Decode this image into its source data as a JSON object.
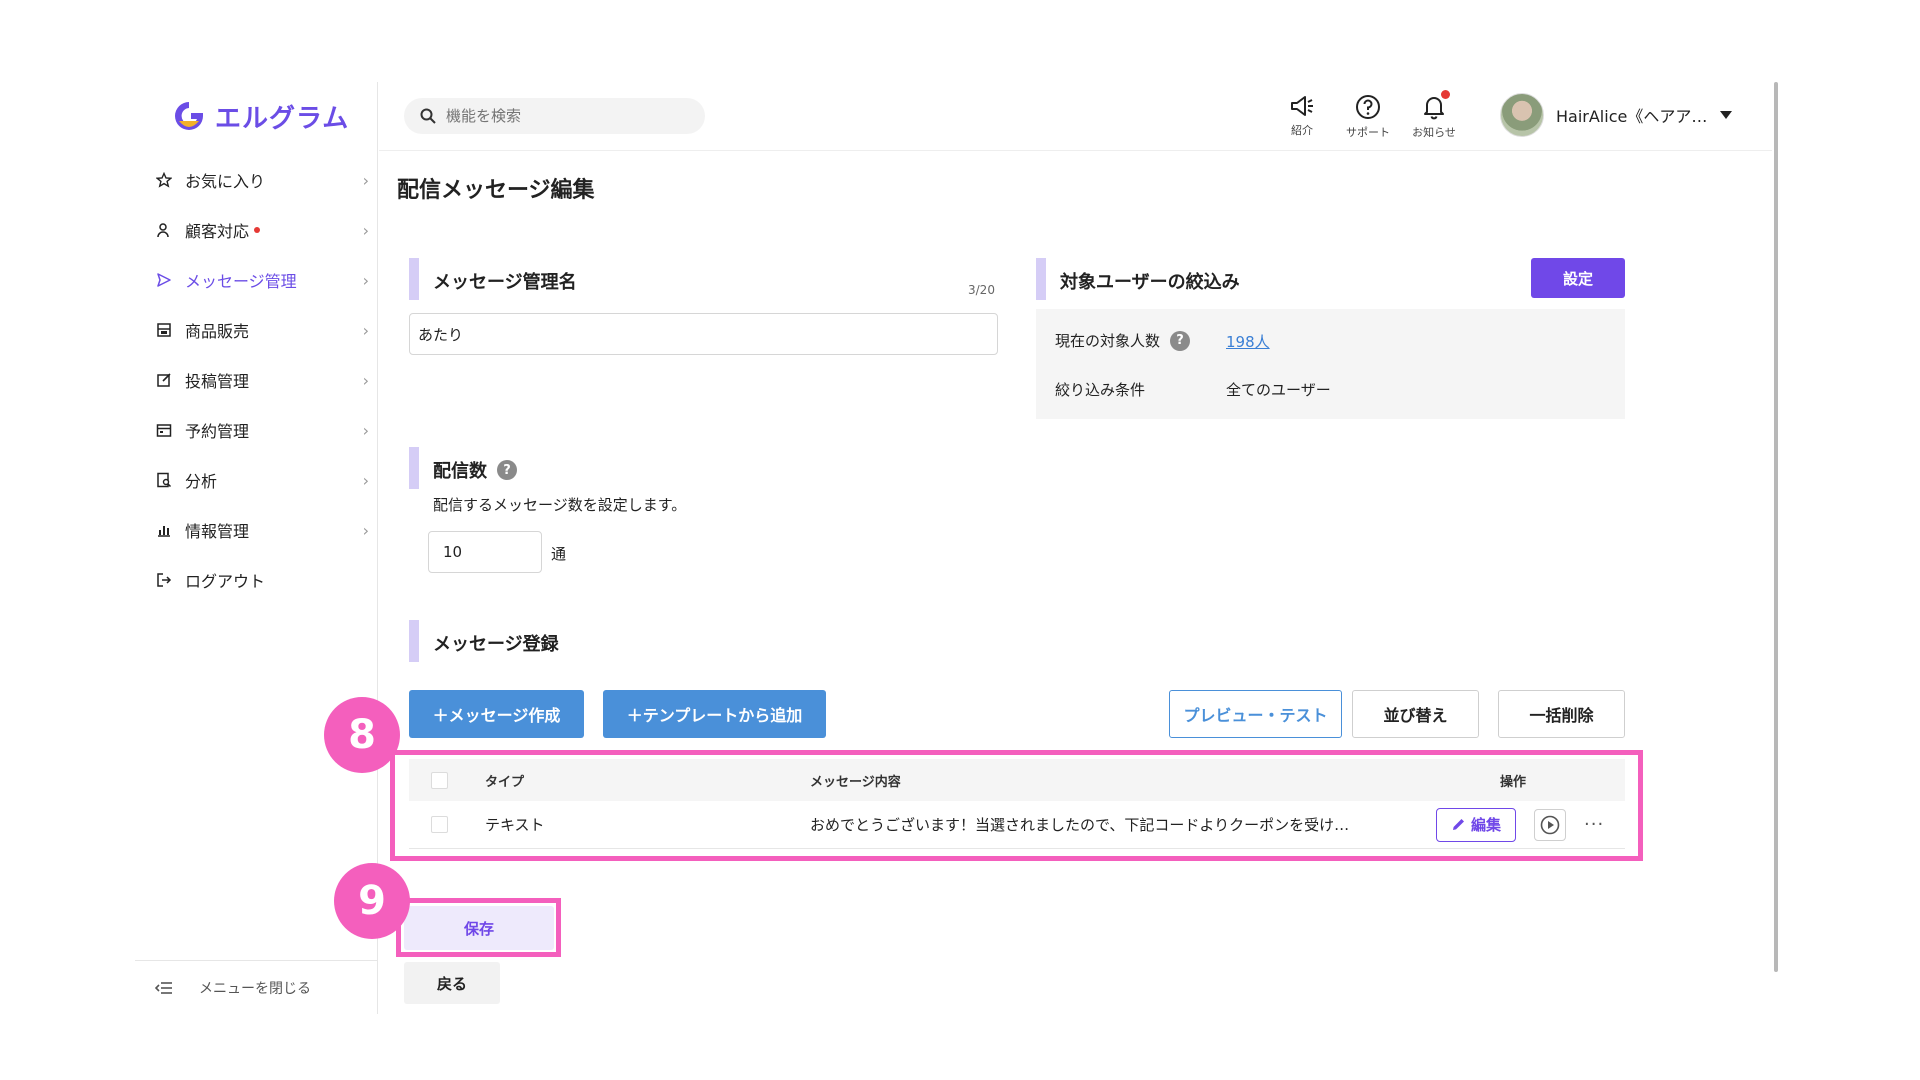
{
  "app": {
    "brand": "エルグラム",
    "accent_color": "#7048e8",
    "annotation_color": "#f45fbd"
  },
  "sidebar": {
    "items": [
      {
        "label": "お気に入り",
        "icon": "star-icon",
        "has_notification": false,
        "active": false
      },
      {
        "label": "顧客対応",
        "icon": "user-icon",
        "has_notification": true,
        "active": false
      },
      {
        "label": "メッセージ管理",
        "icon": "send-icon",
        "has_notification": false,
        "active": true
      },
      {
        "label": "商品販売",
        "icon": "shop-icon",
        "has_notification": false,
        "active": false
      },
      {
        "label": "投稿管理",
        "icon": "edit-icon",
        "has_notification": false,
        "active": false
      },
      {
        "label": "予約管理",
        "icon": "calendar-icon",
        "has_notification": false,
        "active": false
      },
      {
        "label": "分析",
        "icon": "analysis-icon",
        "has_notification": false,
        "active": false
      },
      {
        "label": "情報管理",
        "icon": "chart-icon",
        "has_notification": false,
        "active": false
      },
      {
        "label": "ログアウト",
        "icon": "logout-icon",
        "has_notification": false,
        "active": false
      }
    ],
    "collapse_label": "メニューを閉じる"
  },
  "header": {
    "search_placeholder": "機能を検索",
    "intro_label": "紹介",
    "support_label": "サポート",
    "notice_label": "お知らせ",
    "user_name": "HairAlice《ヘアア…"
  },
  "page": {
    "title": "配信メッセージ編集",
    "message_name": {
      "title": "メッセージ管理名",
      "value": "あたり",
      "char_count": "3/20"
    },
    "target_filter": {
      "title": "対象ユーザーの絞込み",
      "settings_label": "設定",
      "current_count_label": "現在の対象人数",
      "current_count_value": "198人",
      "condition_label": "絞り込み条件",
      "condition_value": "全てのユーザー"
    },
    "send_count": {
      "title": "配信数",
      "description": "配信するメッセージ数を設定します。",
      "value": "10",
      "unit": "通"
    },
    "message_register": {
      "title": "メッセージ登録",
      "create_label": "＋メッセージ作成",
      "template_label": "＋テンプレートから追加",
      "preview_label": "プレビュー・テスト",
      "sort_label": "並び替え",
      "bulk_delete_label": "一括削除"
    },
    "table": {
      "headers": {
        "type": "タイプ",
        "content": "メッセージ内容",
        "actions": "操作"
      },
      "rows": [
        {
          "type": "テキスト",
          "content": "おめでとうございます！当選されましたので、下記コードよりクーポンを受け…",
          "edit_label": "編集",
          "more_label": "···"
        }
      ]
    },
    "save_label": "保存",
    "back_label": "戻る"
  },
  "annotations": {
    "badge_8": "8",
    "badge_9": "9"
  }
}
